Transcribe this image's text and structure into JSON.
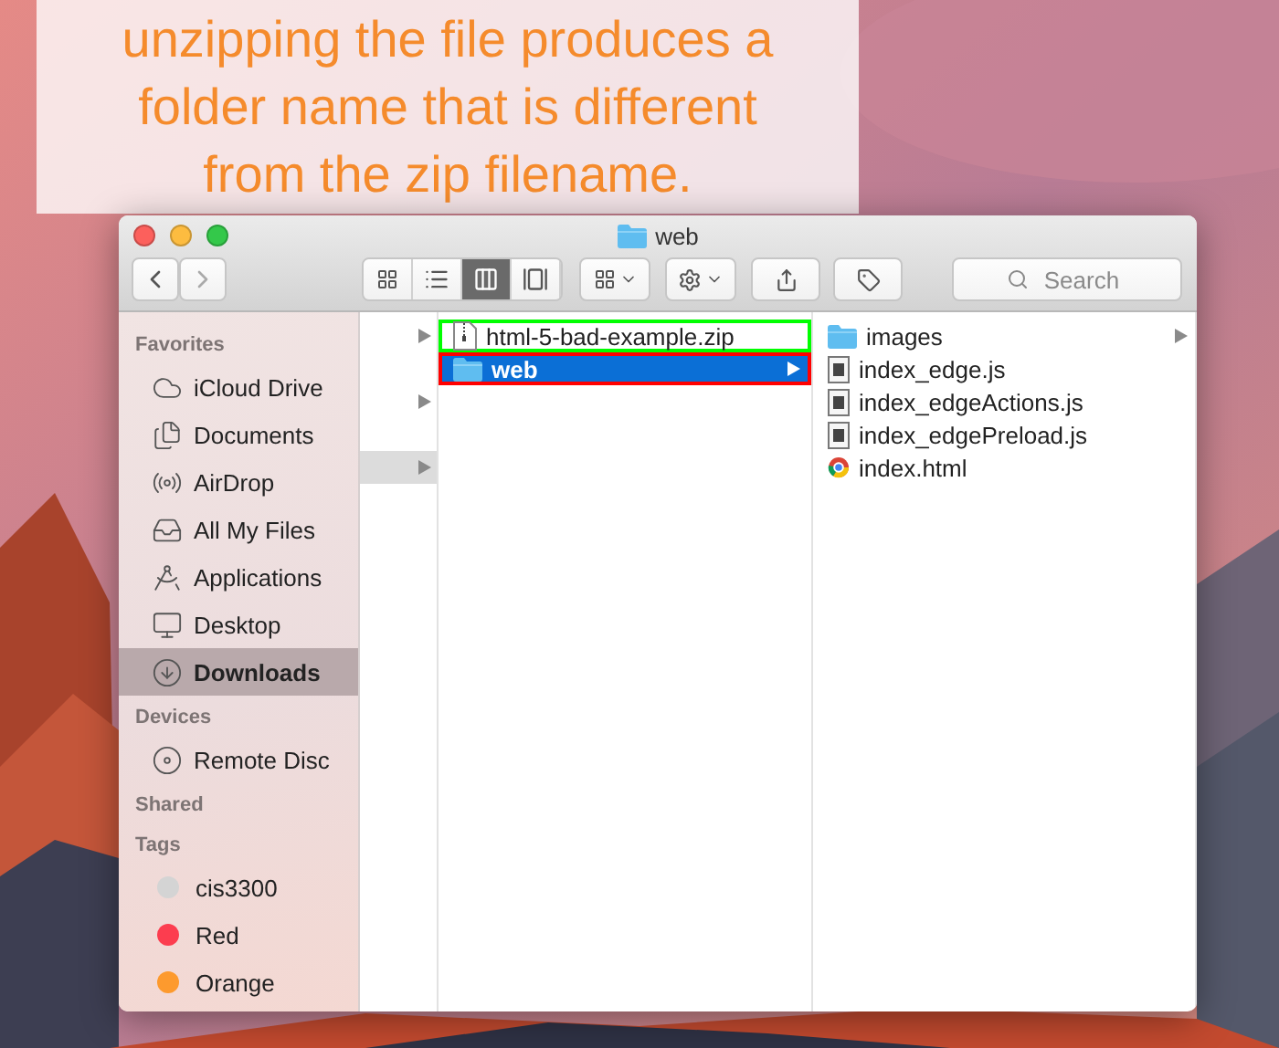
{
  "caption": "unzipping the file produces a folder name that is different from the zip filename.",
  "window": {
    "title": "web"
  },
  "toolbar": {
    "view_modes": [
      {
        "selected": false
      },
      {
        "selected": false
      },
      {
        "selected": true
      },
      {
        "selected": false
      }
    ],
    "search": {
      "placeholder": "Search"
    }
  },
  "sidebar": {
    "sections": [
      {
        "title": "Favorites",
        "items": [
          {
            "label": "iCloud Drive",
            "selected": false
          },
          {
            "label": "Documents",
            "selected": false
          },
          {
            "label": "AirDrop",
            "selected": false
          },
          {
            "label": "All My Files",
            "selected": false
          },
          {
            "label": "Applications",
            "selected": false
          },
          {
            "label": "Desktop",
            "selected": false
          },
          {
            "label": "Downloads",
            "selected": true
          }
        ]
      },
      {
        "title": "Devices",
        "items": [
          {
            "label": "Remote Disc",
            "selected": false
          }
        ]
      },
      {
        "title": "Shared"
      },
      {
        "title": "Tags",
        "tags": [
          {
            "label": "cis3300",
            "color": "#d4d4d4"
          },
          {
            "label": "Red",
            "color": "#fc3d4f"
          },
          {
            "label": "Orange",
            "color": "#fd9a2e"
          }
        ]
      }
    ]
  },
  "column_1": [
    {
      "selected": false
    },
    {
      "selected": false
    },
    {
      "selected": true
    }
  ],
  "column_2": [
    {
      "name": "html-5-bad-example.zip",
      "kind": "zip",
      "selected": false,
      "has_children": false,
      "color": "#00ff00"
    },
    {
      "name": "web",
      "kind": "folder",
      "selected": true,
      "has_children": true,
      "color": "#ff0000"
    }
  ],
  "column_3": [
    {
      "name": "images",
      "kind": "folder",
      "selected": false,
      "has_children": true
    },
    {
      "name": "index_edge.js",
      "kind": "script",
      "selected": false,
      "has_children": false
    },
    {
      "name": "index_edgeActions.js",
      "kind": "script",
      "selected": false,
      "has_children": false
    },
    {
      "name": "index_edgePreload.js",
      "kind": "script",
      "selected": false,
      "has_children": false
    },
    {
      "name": "index.html",
      "kind": "html",
      "selected": false,
      "has_children": false
    }
  ]
}
